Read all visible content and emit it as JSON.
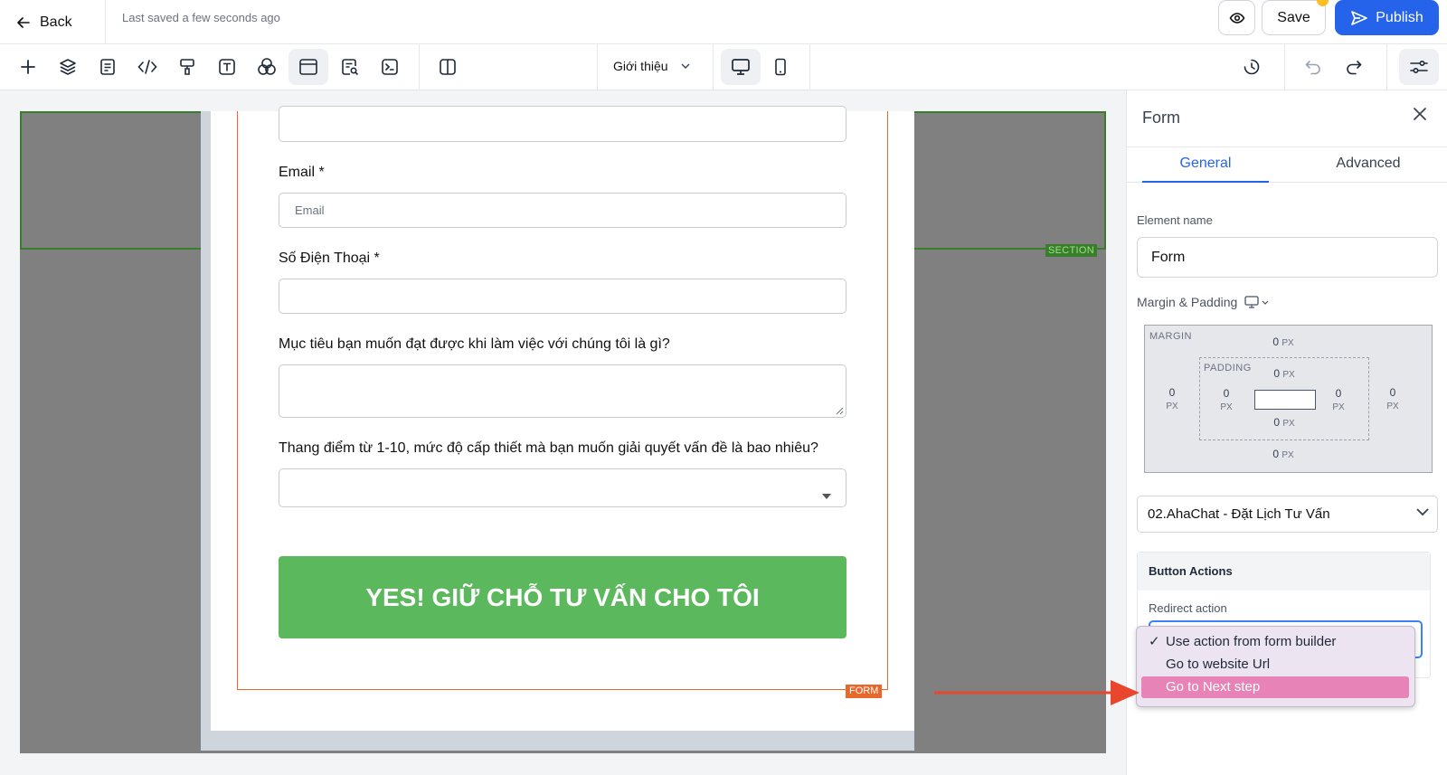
{
  "topbar": {
    "back_label": "Back",
    "saved_status": "Last saved a few seconds ago",
    "save_label": "Save",
    "publish_label": "Publish"
  },
  "toolbar": {
    "tools": [
      "add-icon",
      "layers-icon",
      "page-icon",
      "code-icon",
      "paint-roller-icon",
      "text-icon",
      "shapes-icon",
      "section-icon",
      "form-search-icon",
      "terminal-icon",
      "split-view-icon"
    ],
    "page_select": "Giới thiệu",
    "device": "desktop"
  },
  "canvas": {
    "section_label": "SECTION",
    "form_label": "FORM",
    "fields": [
      {
        "label": "Email *",
        "placeholder": "Email"
      },
      {
        "label": "Số Điện Thoại *",
        "placeholder": ""
      },
      {
        "label": "Mục tiêu bạn muốn đạt được khi làm việc với chúng tôi là gì?",
        "placeholder": ""
      },
      {
        "label": "Thang điểm từ 1-10, mức độ cấp thiết mà bạn muốn giải quyết vấn đề là bao nhiêu?",
        "placeholder": ""
      }
    ],
    "submit_label": "YES! GIỮ CHỖ TƯ VẤN CHO TÔI"
  },
  "panel": {
    "title": "Form",
    "tabs": [
      "General",
      "Advanced"
    ],
    "active_tab": "General",
    "element_name_label": "Element name",
    "element_name_value": "Form",
    "margin_padding_label": "Margin & Padding",
    "margin_label": "MARGIN",
    "padding_label": "PADDING",
    "margin": {
      "top": "0",
      "right": "0",
      "bottom": "0",
      "left": "0"
    },
    "padding": {
      "top": "0",
      "right": "0",
      "bottom": "0",
      "left": "0"
    },
    "unit": "PX",
    "flow_select": "02.AhaChat - Đặt Lịch Tư Vấn",
    "button_actions_label": "Button Actions",
    "redirect_label": "Redirect action"
  },
  "dropdown": {
    "options": [
      "Use action from form builder",
      "Go to website Url",
      "Go to Next step"
    ],
    "checked": "Use action from form builder",
    "highlighted": "Go to Next step",
    "checkmark": "✓"
  },
  "colors": {
    "primary": "#2563eb",
    "section_outline": "#3a7d2c",
    "form_outline": "#e8672a",
    "submit_green": "#5cb85c",
    "highlight": "#e783b6",
    "arrow": "#e8472e"
  }
}
